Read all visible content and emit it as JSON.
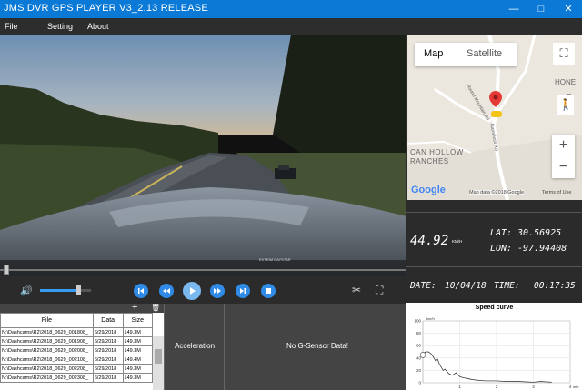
{
  "window": {
    "title": "JMS DVR GPS PLAYER V3_2.13 RELEASE"
  },
  "menu": [
    "File",
    "Setting",
    "About"
  ],
  "video": {
    "overlay_text": "EXTRIM DAYSTAR"
  },
  "map": {
    "tab_map": "Map",
    "tab_satellite": "Satellite",
    "label_hollow": "CAN HOLLOW",
    "label_ranches": "RANCHES",
    "road1": "Round Mountain Rd",
    "road2": "Nameless Rd",
    "label_hone": "HONE",
    "label_e": "E",
    "google": "Google",
    "attribution": "Map data ©2018 Google",
    "terms": "Terms of Use"
  },
  "gps": {
    "speed": "44.92",
    "speed_unit": "KM/H",
    "lat_label": "LAT:",
    "lat_value": "30.56925",
    "lon_label": "LON:",
    "lon_value": "-97.94408",
    "date_label": "DATE:",
    "date_value": "10/04/18",
    "time_label": "TIME:",
    "time_value": "00:17:35"
  },
  "playback": {
    "volume": 0.75,
    "seek": 0.01
  },
  "file_list": {
    "columns": [
      "File",
      "Data",
      "Size"
    ],
    "rows": [
      [
        "N:\\Dashcams\\R2\\2018_0629_001808_",
        "6/29/2018",
        "149.3M"
      ],
      [
        "N:\\Dashcams\\R2\\2018_0629_001908_",
        "6/29/2018",
        "149.3M"
      ],
      [
        "N:\\Dashcams\\R2\\2018_0629_002008_",
        "6/29/2018",
        "149.3M"
      ],
      [
        "N:\\Dashcams\\R2\\2018_0629_002108_",
        "6/29/2018",
        "149.4M"
      ],
      [
        "N:\\Dashcams\\R2\\2018_0629_002208_",
        "6/29/2018",
        "149.3M"
      ],
      [
        "N:\\Dashcams\\R2\\2018_0629_002308_",
        "6/29/2018",
        "149.3M"
      ]
    ],
    "add_symbol": "+",
    "delete_symbol": "🗑"
  },
  "sensor": {
    "acceleration_label": "Acceleration",
    "no_data": "No G-Sensor Data!"
  },
  "speed_chart": {
    "chart_data": {
      "type": "line",
      "title": "Speed curve",
      "ylabel": "km/h",
      "xlabel": "min",
      "ylim": [
        0,
        100
      ],
      "xlim": [
        0,
        4
      ],
      "yticks": [
        "0",
        "20",
        "40",
        "60",
        "80",
        "100"
      ],
      "xticks": [
        "1",
        "2",
        "3",
        "4"
      ],
      "x": [
        0,
        0.05,
        0.1,
        0.15,
        0.2,
        0.25,
        0.3,
        0.35,
        0.4,
        0.45,
        0.5,
        0.55,
        0.6,
        0.7,
        0.8,
        0.9,
        1.0,
        1.1,
        1.2,
        1.35,
        1.5,
        1.7,
        2.0,
        2.3,
        2.6,
        3.0,
        3.2,
        3.5
      ],
      "values": [
        45,
        49,
        50,
        50,
        48,
        45,
        40,
        35,
        38,
        30,
        25,
        20,
        22,
        15,
        12,
        16,
        10,
        8,
        7,
        5,
        4,
        3,
        3,
        2,
        2,
        1,
        2,
        1
      ],
      "marker_x": 0,
      "marker_y": 45
    }
  },
  "colors": {
    "titlebar": "#0a7ad6",
    "button": "#2f8be6",
    "marker": "#e53935"
  }
}
